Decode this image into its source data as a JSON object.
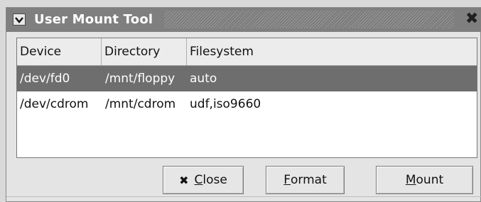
{
  "window": {
    "title": "User Mount Tool"
  },
  "icons": {
    "menu": "chevron-down-icon",
    "close": "close-icon",
    "close_button_icon": "x-icon"
  },
  "table": {
    "columns": [
      "Device",
      "Directory",
      "Filesystem"
    ],
    "rows": [
      {
        "device": "/dev/fd0",
        "directory": "/mnt/floppy",
        "filesystem": "auto",
        "selected": true
      },
      {
        "device": "/dev/cdrom",
        "directory": "/mnt/cdrom",
        "filesystem": "udf,iso9660",
        "selected": false
      }
    ]
  },
  "buttons": {
    "close": {
      "mnemonic": "C",
      "rest": "lose"
    },
    "format": {
      "mnemonic": "F",
      "rest": "ormat"
    },
    "mount": {
      "mnemonic": "M",
      "rest": "ount"
    }
  }
}
